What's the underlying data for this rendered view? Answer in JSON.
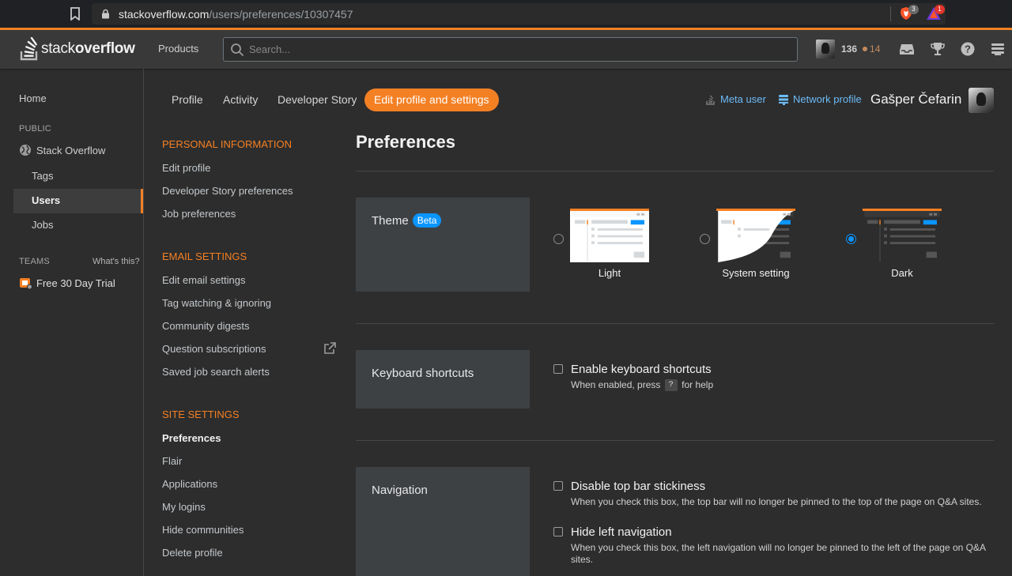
{
  "browser": {
    "url_host": "stackoverflow.com",
    "url_path": "/users/preferences/10307457",
    "brave_shields_count": "3",
    "rewards_count": "1"
  },
  "topbar": {
    "logo_light": "stack",
    "logo_bold": "overflow",
    "products_label": "Products",
    "search_placeholder": "Search...",
    "reputation": "136",
    "bronze_badges": "14",
    "accent_color": "#f48024"
  },
  "left_nav": {
    "home": "Home",
    "public_heading": "PUBLIC",
    "stack_overflow": "Stack Overflow",
    "tags": "Tags",
    "users": "Users",
    "jobs": "Jobs",
    "teams_heading": "TEAMS",
    "whats_this": "What's this?",
    "free_trial": "Free 30 Day Trial"
  },
  "user_tabs": {
    "profile": "Profile",
    "activity": "Activity",
    "developer_story": "Developer Story",
    "edit_profile": "Edit profile and settings",
    "meta_user": "Meta user",
    "network_profile": "Network profile",
    "user_name": "Gašper Čefarin"
  },
  "settings_menu": {
    "personal_heading": "PERSONAL INFORMATION",
    "edit_profile": "Edit profile",
    "dev_story_prefs": "Developer Story preferences",
    "job_prefs": "Job preferences",
    "email_heading": "EMAIL SETTINGS",
    "edit_email": "Edit email settings",
    "tag_watching": "Tag watching & ignoring",
    "community_digests": "Community digests",
    "question_subscriptions": "Question subscriptions",
    "saved_job_alerts": "Saved job search alerts",
    "site_heading": "SITE SETTINGS",
    "preferences": "Preferences",
    "flair": "Flair",
    "applications": "Applications",
    "my_logins": "My logins",
    "hide_communities": "Hide communities",
    "delete_profile": "Delete profile"
  },
  "main": {
    "title": "Preferences",
    "theme": {
      "label": "Theme",
      "badge": "Beta",
      "options": [
        {
          "name": "Light",
          "selected": false
        },
        {
          "name": "System setting",
          "selected": false
        },
        {
          "name": "Dark",
          "selected": true
        }
      ]
    },
    "keyboard": {
      "label": "Keyboard shortcuts",
      "enable_label": "Enable keyboard shortcuts",
      "desc_before": "When enabled, press",
      "key": "?",
      "desc_after": "for help",
      "checked": false
    },
    "navigation": {
      "label": "Navigation",
      "sticky_label": "Disable top bar stickiness",
      "sticky_desc": "When you check this box, the top bar will no longer be pinned to the top of the page on Q&A sites.",
      "leftnav_label": "Hide left navigation",
      "leftnav_desc": "When you check this box, the left navigation will no longer be pinned to the left of the page on Q&A sites."
    }
  }
}
